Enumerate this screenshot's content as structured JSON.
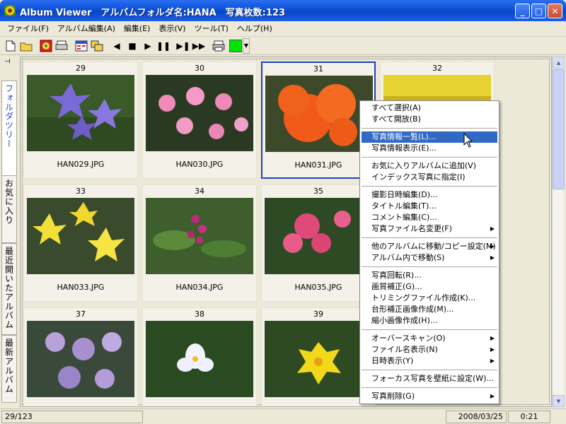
{
  "window": {
    "title": "Album Viewer　アルバムフォルダ名:HANA　写真枚数:123",
    "minimize": "_",
    "maximize": "□",
    "close": "✕"
  },
  "menu": [
    "ファイル(F)",
    "アルバム編集(A)",
    "編集(E)",
    "表示(V)",
    "ツール(T)",
    "ヘルプ(H)"
  ],
  "toolbar": {
    "icons": [
      "new-icon",
      "open-icon",
      "add-photo-icon",
      "print-icon",
      "slideshow-icon",
      "window-icon",
      "prev-icon",
      "stop-icon",
      "play-icon",
      "pause-icon",
      "step-icon",
      "fast-forward-icon",
      "print2-icon",
      "color-icon"
    ],
    "color": "#00e600"
  },
  "sidebar": {
    "tabs": [
      "フォルダツリー",
      "お気に入り",
      "最近開いたアルバム",
      "最新アルバム"
    ]
  },
  "thumbnails": [
    {
      "num": "29",
      "name": "HAN029.JPG"
    },
    {
      "num": "30",
      "name": "HAN030.JPG"
    },
    {
      "num": "31",
      "name": "HAN031.JPG"
    },
    {
      "num": "32",
      "name": ""
    },
    {
      "num": "33",
      "name": "HAN033.JPG"
    },
    {
      "num": "34",
      "name": "HAN034.JPG"
    },
    {
      "num": "35",
      "name": "HAN035.JPG"
    },
    {
      "num": "37",
      "name": ""
    },
    {
      "num": "38",
      "name": ""
    },
    {
      "num": "39",
      "name": ""
    }
  ],
  "context_menu": [
    "すべて選択(A)",
    "すべて開放(B)",
    "写真情報一覧(L)...",
    "写真情報表示(E)...",
    "お気に入りアルバムに追加(V)",
    "インデックス写真に指定(I)",
    "撮影日時編集(D)...",
    "タイトル編集(T)...",
    "コメント編集(C)...",
    "写真ファイル名変更(F)",
    "他のアルバムに移動/コピー設定(M)",
    "アルバム内で移動(S)",
    "写真回転(R)...",
    "画質補正(G)...",
    "トリミングファイル作成(K)...",
    "台形補正画像作成(M)...",
    "縮小画像作成(H)...",
    "オーバースキャン(O)",
    "ファイル名表示(N)",
    "日時表示(Y)",
    "フォーカス写真を壁紙に設定(W)...",
    "写真削除(G)"
  ],
  "status": {
    "position": "29/123",
    "date": "2008/03/25",
    "time": "0:21"
  }
}
